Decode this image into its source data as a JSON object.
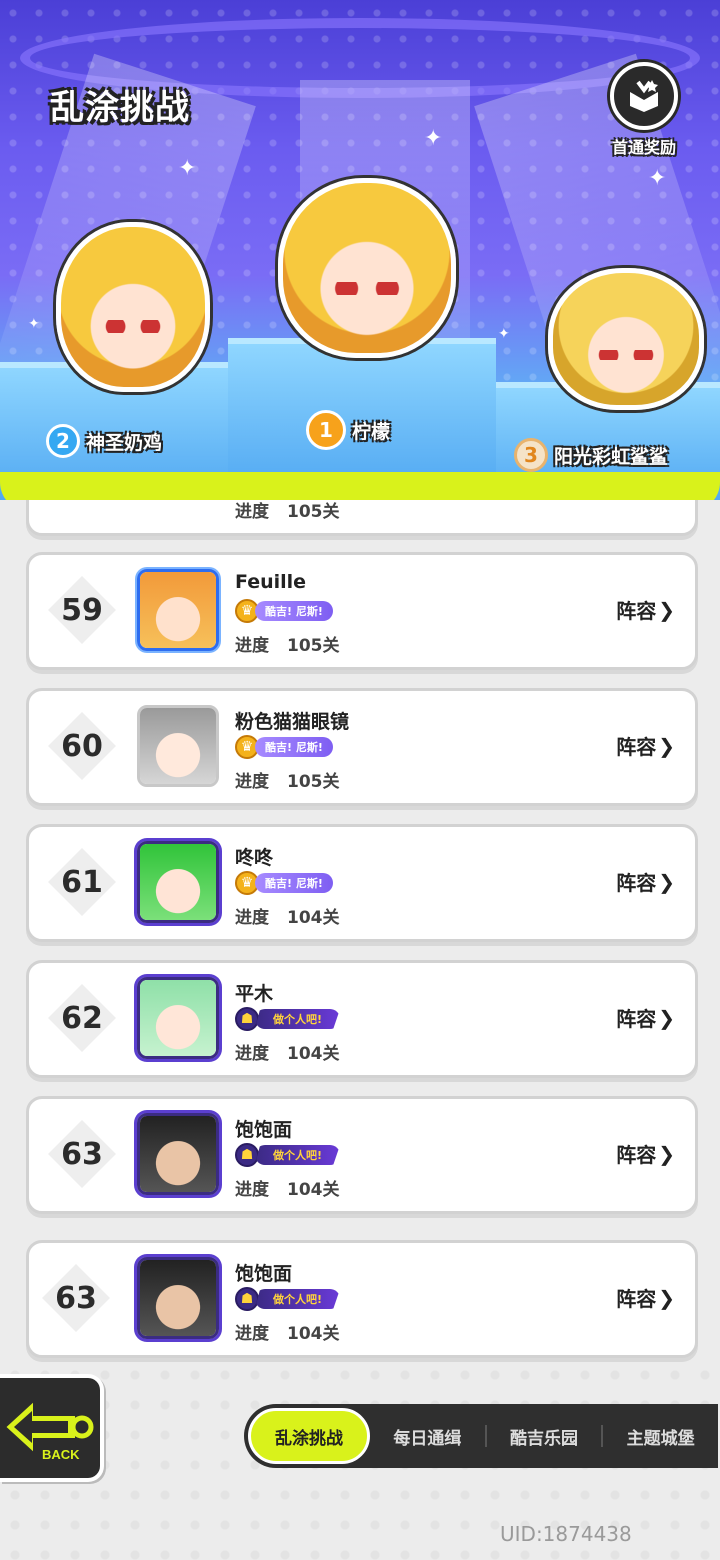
{
  "header": {
    "title": "乱涂挑战",
    "reward_label": "首通奖励"
  },
  "podium": {
    "first": {
      "rank": "1",
      "name": "柠檬"
    },
    "second": {
      "rank": "2",
      "name": "神圣奶鸡"
    },
    "third": {
      "rank": "3",
      "name": "阳光彩虹鲨鲨"
    }
  },
  "list": {
    "progress_label": "进度",
    "lineup_label": "阵容",
    "partial_row": {
      "progress": "105关"
    },
    "rows": [
      {
        "rank": "59",
        "name": "Feuille",
        "badge": "酷吉! 尼斯!",
        "progress": "105关",
        "frame": "blue"
      },
      {
        "rank": "60",
        "name": "粉色猫猫眼镜",
        "badge": "酷吉! 尼斯!",
        "progress": "105关",
        "frame": "plain"
      },
      {
        "rank": "61",
        "name": "咚咚",
        "badge": "酷吉! 尼斯!",
        "progress": "104关",
        "frame": "dark"
      },
      {
        "rank": "62",
        "name": "平木",
        "badge": "做个人吧!",
        "progress": "104关",
        "frame": "dark"
      },
      {
        "rank": "63",
        "name": "饱饱面",
        "badge": "做个人吧!",
        "progress": "104关",
        "frame": "dark"
      }
    ],
    "self_row": {
      "rank": "63",
      "name": "饱饱面",
      "badge": "做个人吧!",
      "progress": "104关"
    }
  },
  "footer": {
    "back_label": "BACK",
    "tabs": [
      "乱涂挑战",
      "每日通缉",
      "酷吉乐园",
      "主题城堡"
    ],
    "active_tab": "乱涂挑战",
    "uid": "UID:1874438"
  },
  "colors": {
    "accent_lime": "#d9f21b",
    "stage_purple": "#6b5cf0",
    "dark_bar": "#2f2f2f"
  }
}
